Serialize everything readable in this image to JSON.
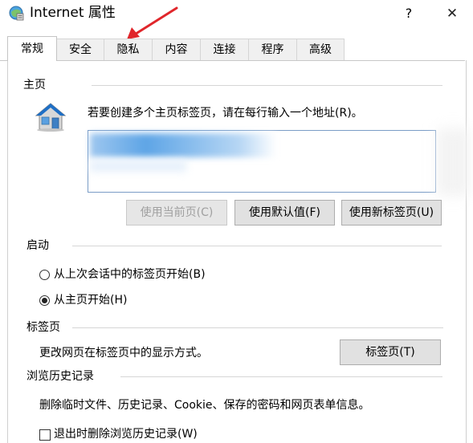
{
  "window": {
    "title": "Internet 属性",
    "help_label": "?",
    "close_label": "✕"
  },
  "tabs": [
    {
      "label": "常规",
      "active": true
    },
    {
      "label": "安全",
      "active": false
    },
    {
      "label": "隐私",
      "active": false
    },
    {
      "label": "内容",
      "active": false
    },
    {
      "label": "连接",
      "active": false
    },
    {
      "label": "程序",
      "active": false
    },
    {
      "label": "高级",
      "active": false
    }
  ],
  "homepage": {
    "header": "主页",
    "instruction": "若要创建多个主页标签页，请在每行输入一个地址(R)。",
    "address_value": "",
    "buttons": {
      "use_current": "使用当前页(C)",
      "use_default": "使用默认值(F)",
      "use_new_tab": "使用新标签页(U)"
    }
  },
  "startup": {
    "header": "启动",
    "options": [
      {
        "label": "从上次会话中的标签页开始(B)",
        "selected": false
      },
      {
        "label": "从主页开始(H)",
        "selected": true
      }
    ]
  },
  "tabs_section": {
    "header": "标签页",
    "description": "更改网页在标签页中的显示方式。",
    "button": "标签页(T)"
  },
  "history": {
    "header": "浏览历史记录",
    "description": "删除临时文件、历史记录、Cookie、保存的密码和网页表单信息。",
    "checkbox_label": "退出时删除浏览历史记录(W)",
    "checkbox_checked": false
  },
  "colors": {
    "annotation_arrow": "#e0262b",
    "address_border": "#7a9cc6"
  }
}
